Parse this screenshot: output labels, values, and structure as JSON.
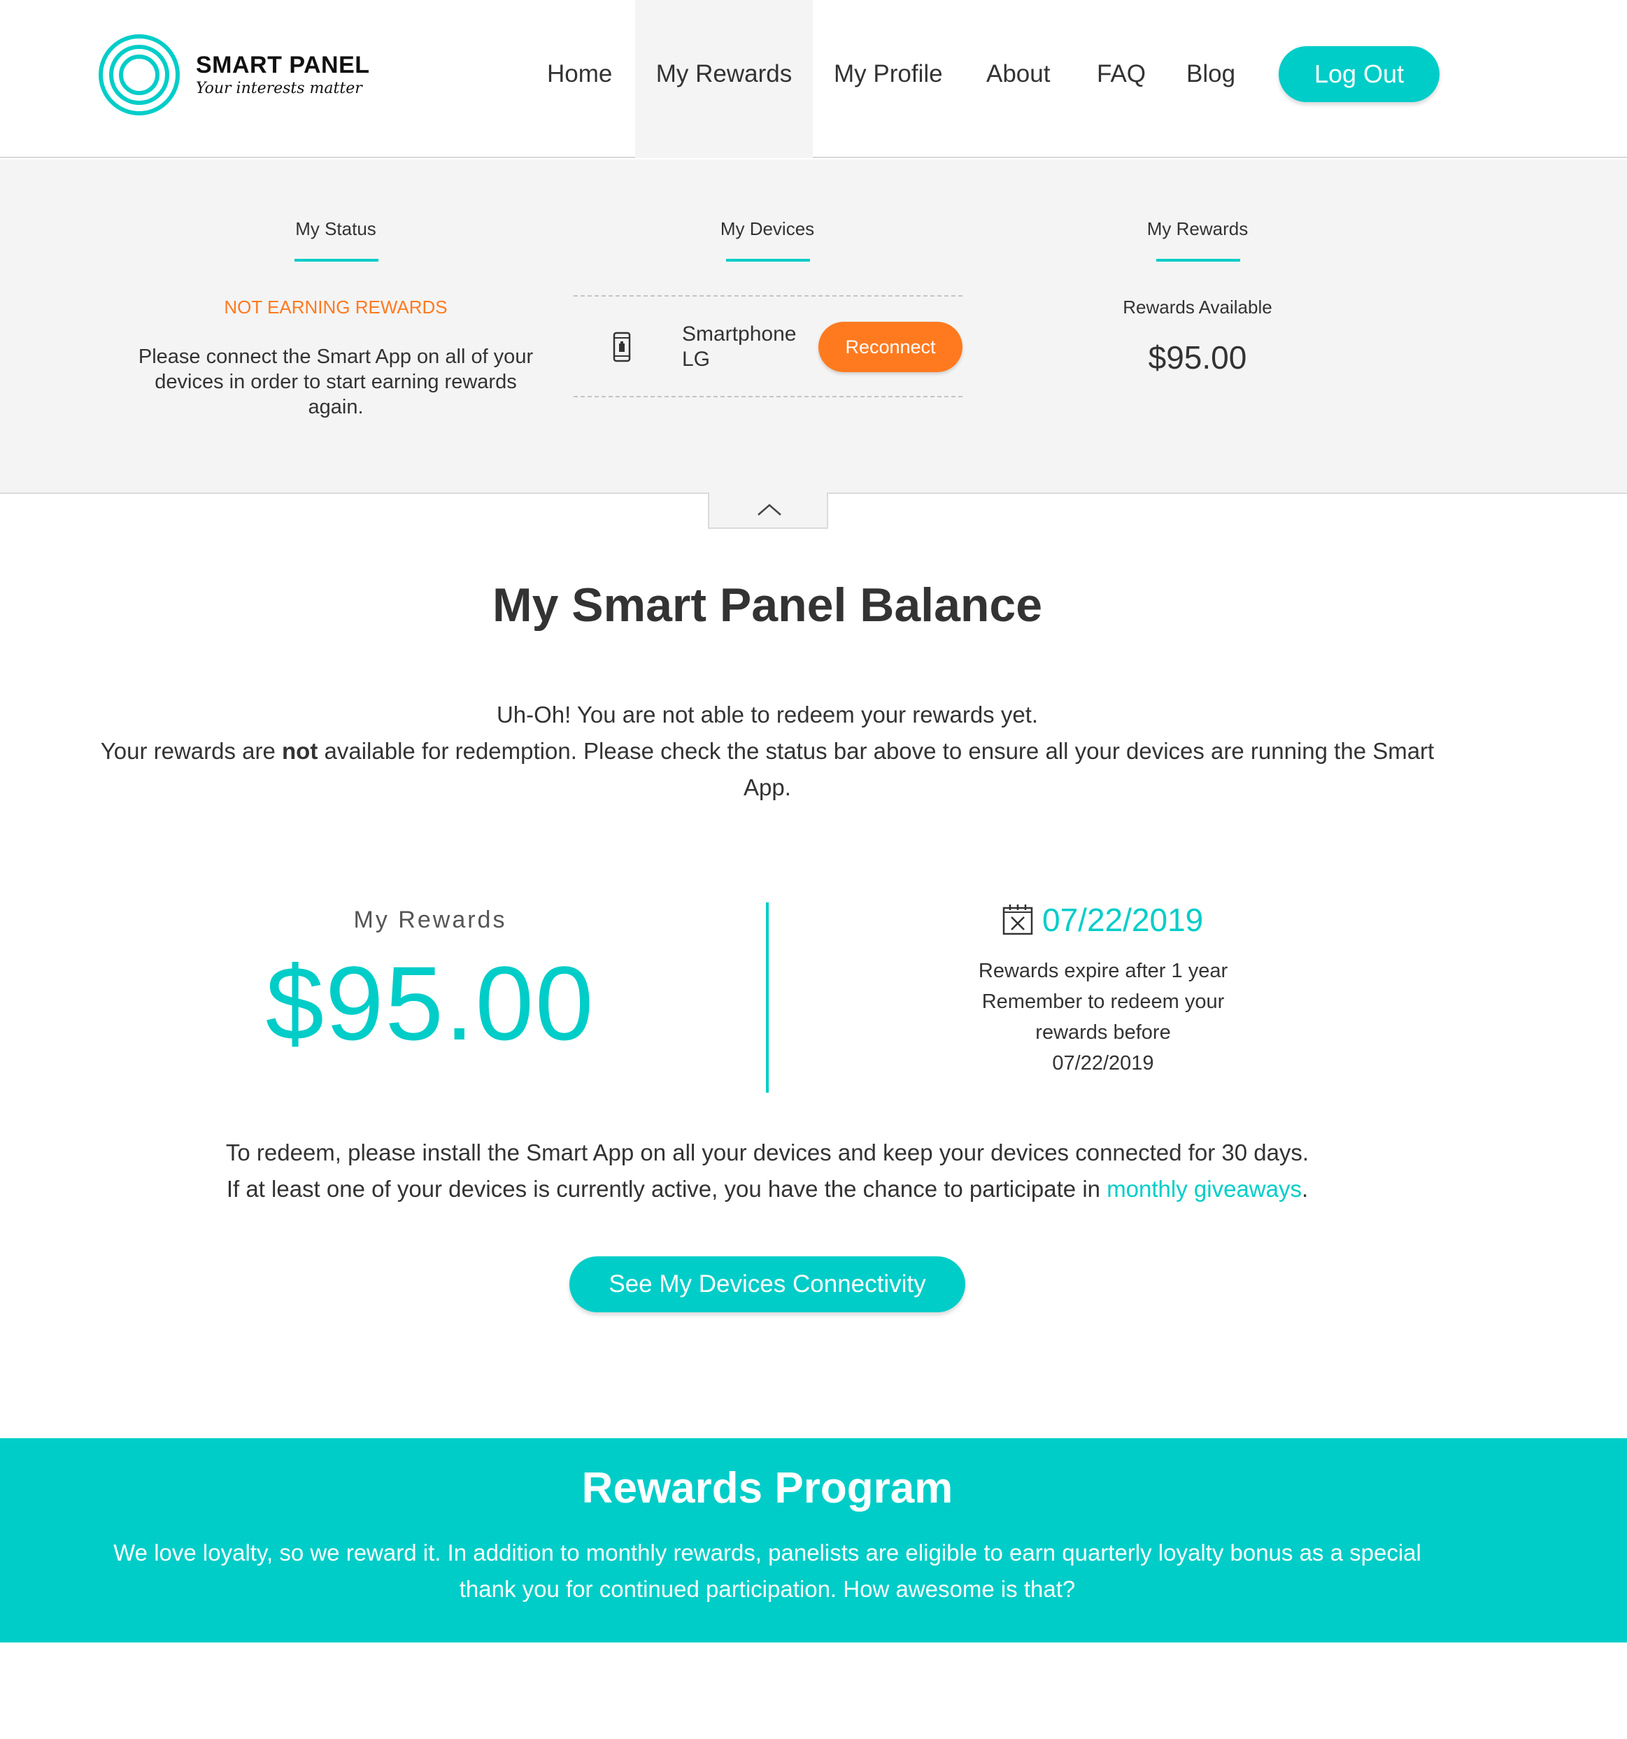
{
  "header": {
    "logo_name": "SMART PANEL",
    "logo_tagline": "Your interests matter",
    "nav": [
      {
        "label": "Home"
      },
      {
        "label": "My Rewards"
      },
      {
        "label": "My Profile"
      },
      {
        "label": "About"
      },
      {
        "label": "FAQ"
      },
      {
        "label": "Blog"
      }
    ],
    "active_nav": "My Rewards",
    "logout_label": "Log Out"
  },
  "status_panel": {
    "status": {
      "title": "My Status",
      "warning": "NOT EARNING REWARDS",
      "message": "Please connect the Smart App on all of your devices in order to start earning rewards again."
    },
    "devices": {
      "title": "My Devices",
      "items": [
        {
          "icon": "smartphone-icon",
          "name_line1": "Smartphone",
          "name_line2": "LG",
          "action_label": "Reconnect"
        }
      ]
    },
    "rewards": {
      "title": "My Rewards",
      "available_label": "Rewards Available",
      "available_value": "$95.00"
    },
    "collapse_icon": "chevron-up-icon"
  },
  "balance": {
    "title": "My Smart Panel Balance",
    "line1": "Uh-Oh! You are not able to redeem your rewards yet.",
    "line2_pre": "Your rewards are ",
    "line2_bold": "not",
    "line2_post": " available for redemption. Please check the status bar above to ensure all your devices are running the Smart App.",
    "my_rewards_label": "My Rewards",
    "my_rewards_value": "$95.00",
    "expiry_icon": "calendar-x-icon",
    "expiry_date": "07/22/2019",
    "expiry_note_1": "Rewards expire after 1 year",
    "expiry_note_2": "Remember to redeem your",
    "expiry_note_3": "rewards before",
    "expiry_note_4": "07/22/2019",
    "redeem_line1": "To redeem, please install the Smart App on all your devices and keep your devices connected for 30 days.",
    "redeem_line2_pre": "If at least one of your devices is currently active, you have the chance to participate in ",
    "redeem_link": "monthly giveaways",
    "redeem_line2_post": ".",
    "cta_label": "See My Devices Connectivity"
  },
  "rewards_program": {
    "title": "Rewards Program",
    "text": "We love loyalty, so we reward it. In addition to monthly rewards, panelists are eligible to earn quarterly loyalty bonus as a special thank you for continued participation. How awesome is that?"
  },
  "colors": {
    "accent": "#00cdc8",
    "warning": "#ff7a1f",
    "panel_bg": "#f4f4f4",
    "text": "#333333"
  }
}
